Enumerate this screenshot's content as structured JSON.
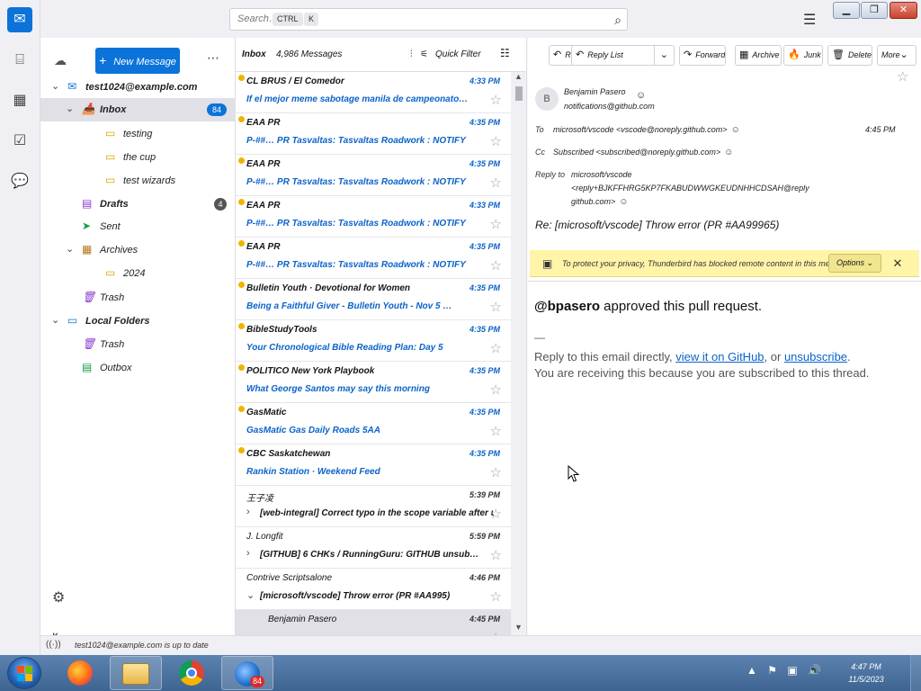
{
  "titlebar": {
    "search_placeholder": "Search…",
    "shortcut_ctrl": "CTRL",
    "shortcut_k": "K"
  },
  "spaces": [
    "Mail",
    "Address Book",
    "Calendar",
    "Tasks",
    "Chat"
  ],
  "folderpane": {
    "new_message": "New Message",
    "folders": [
      {
        "label": "test1024@example.com",
        "icon": "account-icon",
        "level": 0,
        "twisty": "open"
      },
      {
        "label": "Inbox",
        "icon": "inbox-icon",
        "level": 1,
        "twisty": "open",
        "badge": "84",
        "selected": true
      },
      {
        "label": "testing",
        "icon": "folder-icon",
        "level": 2
      },
      {
        "label": "the cup",
        "icon": "folder-icon",
        "level": 2
      },
      {
        "label": "test wizards",
        "icon": "folder-icon",
        "level": 2
      },
      {
        "label": "Drafts",
        "icon": "drafts-icon",
        "level": 1,
        "badge": "4"
      },
      {
        "label": "Sent",
        "icon": "sent-icon",
        "level": 1
      },
      {
        "label": "Archives",
        "icon": "archive-icon",
        "level": 1,
        "twisty": "open"
      },
      {
        "label": "2024",
        "icon": "folder-icon",
        "level": 2
      },
      {
        "label": "Trash",
        "icon": "trash-icon",
        "level": 1
      },
      {
        "label": "Local Folders",
        "icon": "local-folders-icon",
        "level": 0,
        "twisty": "open"
      },
      {
        "label": "Trash",
        "icon": "trash-icon",
        "level": 1
      },
      {
        "label": "Outbox",
        "icon": "outbox-icon",
        "level": 1
      }
    ]
  },
  "listpane": {
    "folder_name": "Inbox",
    "count": "4,986 Messages",
    "quick_filter": "Quick Filter",
    "messages": [
      {
        "from": "CL BRUS / El Comedor",
        "subject": "If el mejor meme sabotage manila de campeonato…",
        "date": "4:33 PM",
        "unread": true
      },
      {
        "from": "EAA PR",
        "subject": "P-##… PR Tasvaltas: Tasvaltas Roadwork : NOTIFY",
        "date": "4:35 PM",
        "unread": true
      },
      {
        "from": "EAA PR",
        "subject": "P-##… PR Tasvaltas: Tasvaltas Roadwork : NOTIFY",
        "date": "4:35 PM",
        "unread": true
      },
      {
        "from": "EAA PR",
        "subject": "P-##… PR Tasvaltas: Tasvaltas Roadwork : NOTIFY",
        "date": "4:33 PM",
        "unread": true
      },
      {
        "from": "EAA PR",
        "subject": "P-##… PR Tasvaltas: Tasvaltas Roadwork : NOTIFY",
        "date": "4:35 PM",
        "unread": true
      },
      {
        "from": "Bulletin Youth · Devotional for Women",
        "subject": "Being a Faithful Giver - Bulletin Youth - Nov 5 …",
        "date": "4:35 PM",
        "unread": true
      },
      {
        "from": "BibleStudyTools",
        "subject": "Your Chronological Bible Reading Plan: Day 5",
        "date": "4:35 PM",
        "unread": true
      },
      {
        "from": "POLITICO New York Playbook",
        "subject": "What George Santos may say this morning",
        "date": "4:35 PM",
        "unread": true
      },
      {
        "from": "GasMatic",
        "subject": "GasMatic Gas Daily Roads 5AA",
        "date": "4:35 PM",
        "unread": true
      },
      {
        "from": "CBC Saskatchewan",
        "subject": "Rankin Station · Weekend Feed",
        "date": "4:35 PM",
        "unread": true
      },
      {
        "from": "王子凌",
        "subject": "[web-integral] Correct typo in the scope variable after using it…",
        "date": "5:39 PM",
        "unread": false,
        "thread": "closed"
      },
      {
        "from": "J. Longfit",
        "subject": "[GITHUB] 6 CHKs / RunningGuru: GITHUB unsub…",
        "date": "5:59 PM",
        "unread": false,
        "thread": "closed"
      },
      {
        "from": "Contrive Scriptsalone",
        "subject": "[microsoft/vscode] Throw error (PR #AA995)",
        "date": "4:46 PM",
        "unread": false,
        "thread": "open"
      },
      {
        "from": "Benjamin Pasero",
        "subject": "",
        "date": "4:45 PM",
        "unread": false,
        "selected": true
      }
    ]
  },
  "reader": {
    "buttons": [
      {
        "label": "Reply",
        "icon": "reply-icon"
      },
      {
        "label": "Reply List",
        "icon": "reply-list-icon"
      },
      {
        "label": "Forward",
        "icon": "forward-icon"
      },
      {
        "label": "Archive",
        "icon": "archive-icon"
      },
      {
        "label": "Junk",
        "icon": "junk-icon"
      },
      {
        "label": "Delete",
        "icon": "delete-icon"
      },
      {
        "label": "More",
        "icon": "chevron-down-icon"
      }
    ],
    "from_name": "Benjamin Pasero",
    "from_email": "notifications@github.com",
    "to_label": "To",
    "to_value": "microsoft/vscode <vscode@noreply.github.com>",
    "date": "4:45 PM",
    "cc_label": "Cc",
    "cc_value": "Subscribed <subscribed@noreply.github.com>",
    "replyto_label": "Reply to",
    "replyto_value_1": "microsoft/vscode",
    "replyto_value_2": "<reply+BJKFFHRG5KP7FKABUDWWGKEUDNHHCDSAH@reply",
    "replyto_value_3": "github.com>",
    "subject": "Re: [microsoft/vscode] Throw error (PR #AA99965)",
    "notice": "To protect your privacy, Thunderbird has blocked remote content in this message.",
    "notice_options": "Options",
    "body": {
      "author": "@bpasero",
      "action": " approved this pull request.",
      "dash": "—",
      "reply_prefix": "Reply to this email directly, ",
      "link_github": "view it on GitHub",
      "reply_mid": ", or ",
      "link_unsub": "unsubscribe",
      "reply_suffix": ".",
      "receiving": "You are receiving this because you are subscribed to this thread."
    }
  },
  "statusbar": {
    "text": "test1024@example.com is up to date"
  },
  "taskbar": {
    "apps": [
      "Firefox",
      "File Explorer",
      "Chrome",
      "Thunderbird"
    ],
    "thunderbird_badge": "84",
    "clock_time": "4:47 PM",
    "clock_date": "11/5/2023"
  }
}
